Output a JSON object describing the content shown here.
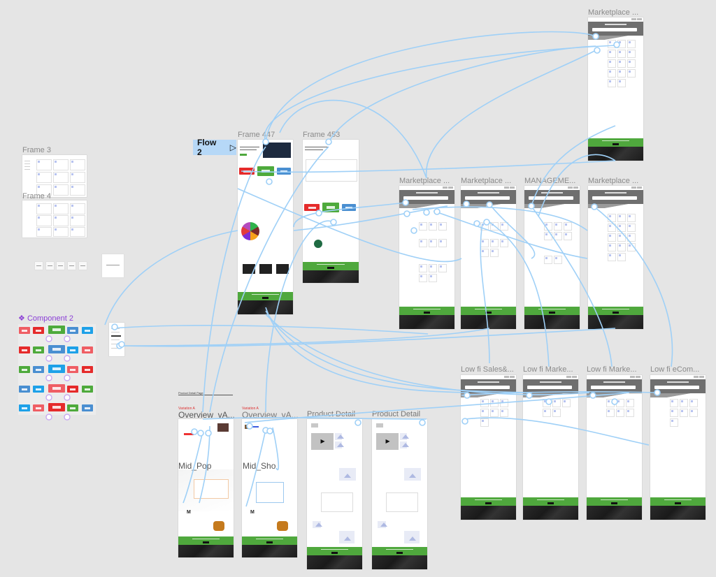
{
  "canvas": {
    "background": "#e5e5e5",
    "connector_color": "#9fd0f7",
    "prototype_accent": "#b6d8f7",
    "component_accent": "#8b3fd6"
  },
  "flow": {
    "label": "Flow 2",
    "play_icon": "▷"
  },
  "frames": {
    "frame3": "Frame 3",
    "frame4": "Frame 4",
    "frame447": "Frame 447",
    "frame453": "Frame 453",
    "marketplace_top": "Marketplace ...",
    "marketplace_1": "Marketplace ...",
    "marketplace_2": "Marketplace ...",
    "management": "MANAGEME...",
    "marketplace_3": "Marketplace ...",
    "lowfi_sales": "Low fi Sales&...",
    "lowfi_marke1": "Low fi Marke...",
    "lowfi_marke2": "Low fi Marke...",
    "lowfi_ecom": "Low fi eCom...",
    "overview_a1": "Overview_vA...",
    "overview_a2": "Overview_vA...",
    "product_detail_1": "Product Detail",
    "product_detail_2": "Product Detail",
    "mid_pop": "Mid_Pop",
    "mid_sho": "Mid_Sho"
  },
  "component": {
    "title": "Component 2",
    "icon": "❖"
  },
  "annotations": {
    "product_detail_page": "Product Detail Page",
    "variation_a_1": "Variation A",
    "variation_a_2": "Variation A"
  }
}
